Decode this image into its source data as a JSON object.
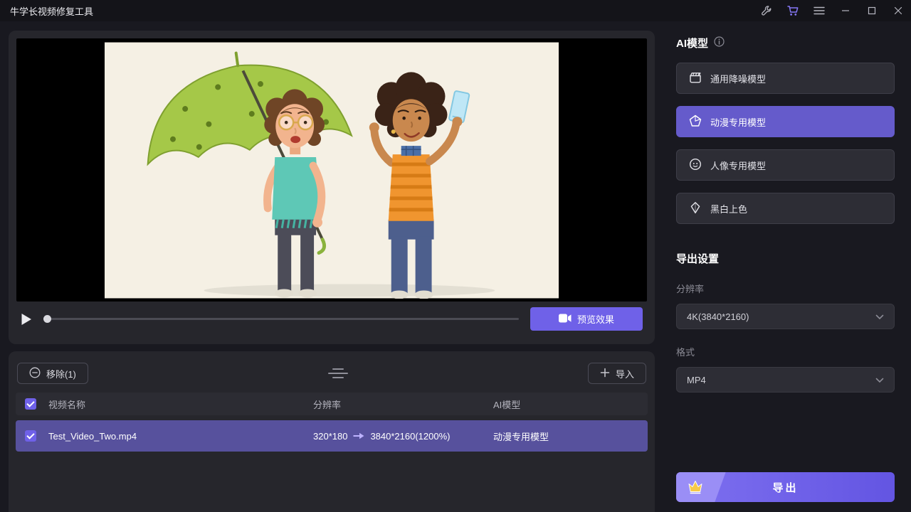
{
  "accent_color": "#6F61E8",
  "selected_row_color": "#57519D",
  "titlebar": {
    "title": "牛学长视频修复工具"
  },
  "player": {
    "preview_button_label": "预览效果"
  },
  "file_list": {
    "remove_button_label": "移除(1)",
    "import_button_label": "导入",
    "headers": {
      "name": "视频名称",
      "resolution": "分辨率",
      "model": "AI模型"
    },
    "rows": [
      {
        "name": "Test_Video_Two.mp4",
        "resolution_from": "320*180",
        "resolution_to": "3840*2160(1200%)",
        "model": "动漫专用模型"
      }
    ]
  },
  "sidebar": {
    "ai_model_title": "AI模型",
    "models": [
      {
        "label": "通用降噪模型",
        "icon": "clapperboard-icon"
      },
      {
        "label": "动漫专用模型",
        "icon": "anime-pentagon-icon"
      },
      {
        "label": "人像专用模型",
        "icon": "portrait-face-icon"
      },
      {
        "label": "黑白上色",
        "icon": "colorize-diamond-icon"
      }
    ],
    "active_model_index": 1,
    "export_settings_title": "导出设置",
    "resolution_label": "分辨率",
    "resolution_value": "4K(3840*2160)",
    "format_label": "格式",
    "format_value": "MP4",
    "export_button_label": "导出"
  }
}
